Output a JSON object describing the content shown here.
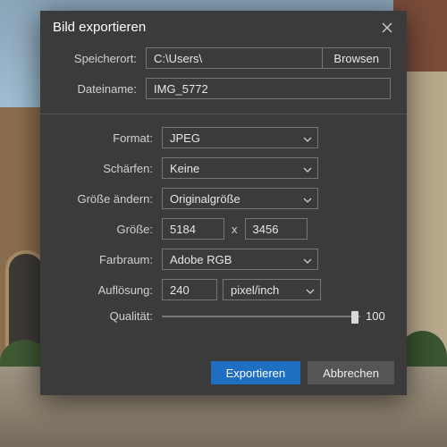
{
  "dialog": {
    "title": "Bild exportieren",
    "close_icon": "close"
  },
  "location": {
    "label": "Speicherort:",
    "value": "C:\\Users\\",
    "browse": "Browsen"
  },
  "filename": {
    "label": "Dateiname:",
    "value": "IMG_5772"
  },
  "format": {
    "label": "Format:",
    "value": "JPEG"
  },
  "sharpen": {
    "label": "Schärfen:",
    "value": "Keine"
  },
  "resize": {
    "label": "Größe ändern:",
    "value": "Originalgröße"
  },
  "size": {
    "label": "Größe:",
    "width": "5184",
    "height": "3456",
    "sep": "x"
  },
  "colorspace": {
    "label": "Farbraum:",
    "value": "Adobe RGB"
  },
  "resolution": {
    "label": "Auflösung:",
    "value": "240",
    "unit": "pixel/inch"
  },
  "quality": {
    "label": "Qualität:",
    "value": "100"
  },
  "actions": {
    "export": "Exportieren",
    "cancel": "Abbrechen"
  }
}
